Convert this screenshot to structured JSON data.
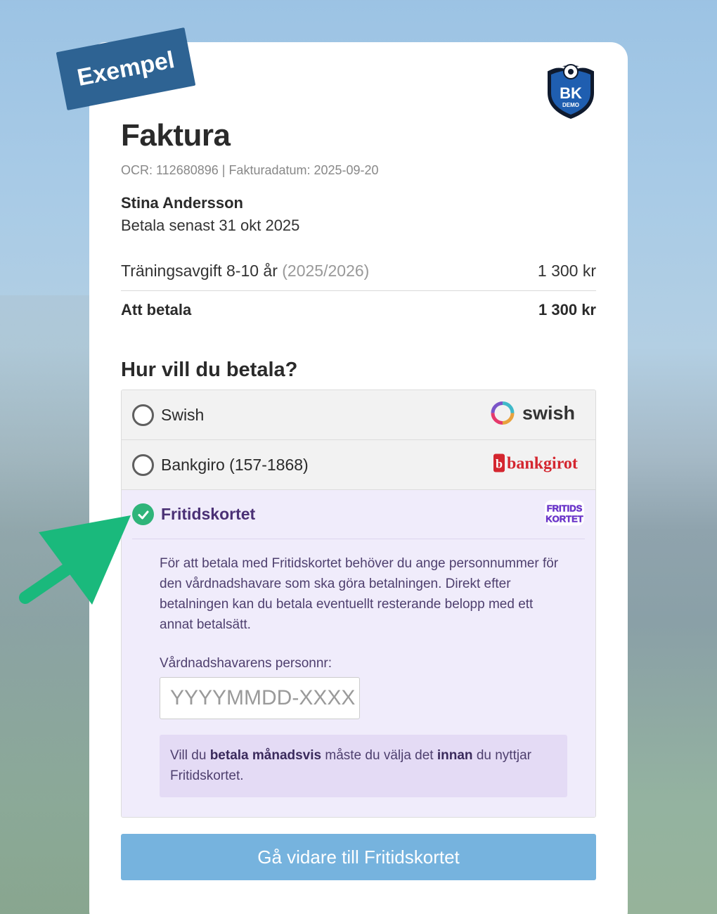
{
  "badge": "Exempel",
  "invoice": {
    "title": "Faktura",
    "meta": "OCR: 112680896 | Fakturadatum: 2025-09-20",
    "customer": "Stina Andersson",
    "due": "Betala senast 31 okt 2025",
    "item": {
      "name": "Träningsavgift 8-10 år",
      "period": "(2025/2026)",
      "amount": "1 300 kr"
    },
    "total": {
      "label": "Att betala",
      "amount": "1 300 kr"
    }
  },
  "logo": {
    "text": "BK",
    "sub": "DEMO"
  },
  "payment": {
    "heading": "Hur vill du betala?",
    "methods": [
      {
        "label": "Swish",
        "logo": "swish",
        "selected": false
      },
      {
        "label": "Bankgiro (157-1868)",
        "logo": "bankgirot",
        "selected": false
      },
      {
        "label": "Fritidskortet",
        "logo": "FRITIDS KORTET",
        "selected": true
      }
    ],
    "fritids": {
      "description": "För att betala med Fritidskortet behöver du ange personnummer för den vårdnadshavare som ska göra betalningen. Direkt efter betalningen kan du betala eventuellt resterande belopp med ett annat betalsätt.",
      "field_label": "Vårdnadshavarens personnr:",
      "placeholder": "YYYYMMDD-XXXX",
      "notice_1": "Vill du ",
      "notice_bold_1": "betala månadsvis",
      "notice_2": " måste du välja det ",
      "notice_bold_2": "innan",
      "notice_3": " du nyttjar Fritidskortet."
    }
  },
  "cta": "Gå vidare till Fritidskortet",
  "colors": {
    "accent": "#2fb47a",
    "button": "#76b3de",
    "badge": "#2e6393",
    "purple_bg": "#f0ecfb"
  }
}
